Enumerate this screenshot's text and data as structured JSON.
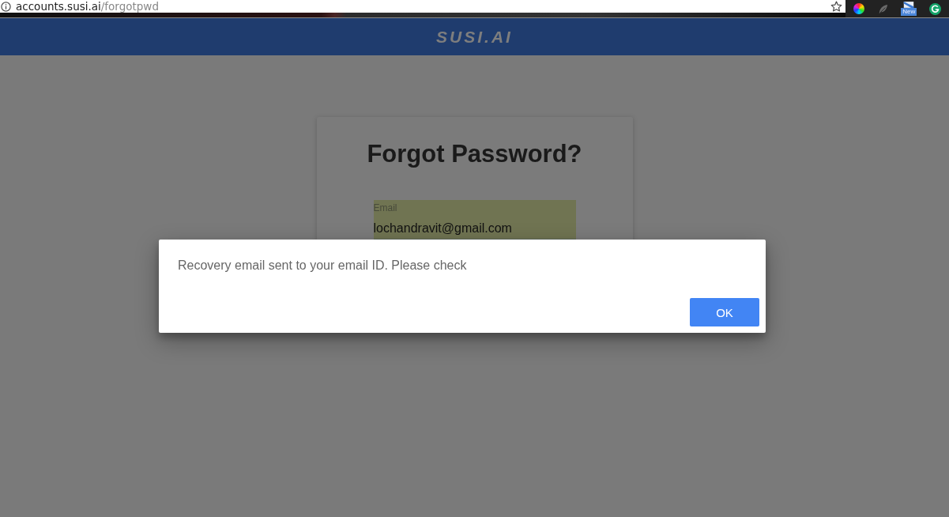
{
  "browser": {
    "url": {
      "host": "accounts.susi.ai",
      "path": "/forgotpwd"
    },
    "bookmarked": false,
    "extensions": [
      {
        "kind": "color-wheel"
      },
      {
        "kind": "feather"
      },
      {
        "kind": "badge",
        "badge": "New"
      },
      {
        "kind": "circle-arrow"
      }
    ]
  },
  "header": {
    "logo": "SUSI.AI"
  },
  "card": {
    "title": "Forgot Password?",
    "email_field": {
      "label": "Email",
      "value": "lochandravit@gmail.com",
      "autofilled": true
    }
  },
  "dialog": {
    "message": "Recovery email sent to your email ID. Please check",
    "buttons": [
      {
        "label": "OK",
        "primary": true
      }
    ]
  }
}
